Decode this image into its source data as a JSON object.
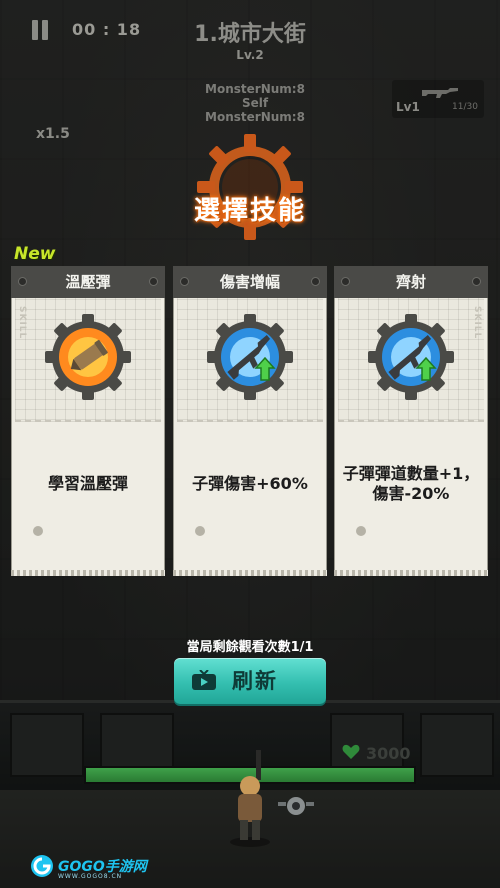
{
  "hud": {
    "timer": "00 : 18",
    "stage_title": "1.城市大街",
    "stage_level": "Lv.2",
    "monster_num": "MonsterNum:8",
    "self_monster_num": "Self MonsterNum:8",
    "speed": "x1.5",
    "weapon_level": "Lv1",
    "weapon_ammo": "11/30"
  },
  "skill_select": {
    "heading": "選擇技能",
    "new_tag": "New",
    "side_mark": "SKILL",
    "cards": [
      {
        "name": "溫壓彈",
        "description": "學習溫壓彈",
        "icon": "thermobaric-bullet-icon"
      },
      {
        "name": "傷害增幅",
        "description": "子彈傷害+60%",
        "icon": "rifle-upgrade-icon"
      },
      {
        "name": "齊射",
        "description": "子彈彈道數量+1，傷害-20%",
        "icon": "rifle-upgrade-icon"
      }
    ]
  },
  "refresh": {
    "watch_count": "當局剩餘觀看次數1/1",
    "label": "刷新",
    "icon": "tv-play-icon"
  },
  "player": {
    "hp": "3000",
    "hp_fraction": 1.0
  },
  "watermark": {
    "text": "GOGO手游网",
    "sub": "WWW.GOGO8.CN"
  },
  "colors": {
    "accent_orange": "#ff7b1a",
    "new_tag": "#c8e62a",
    "refresh_button": "#34bfb0",
    "card_header": "#4a4a47"
  }
}
